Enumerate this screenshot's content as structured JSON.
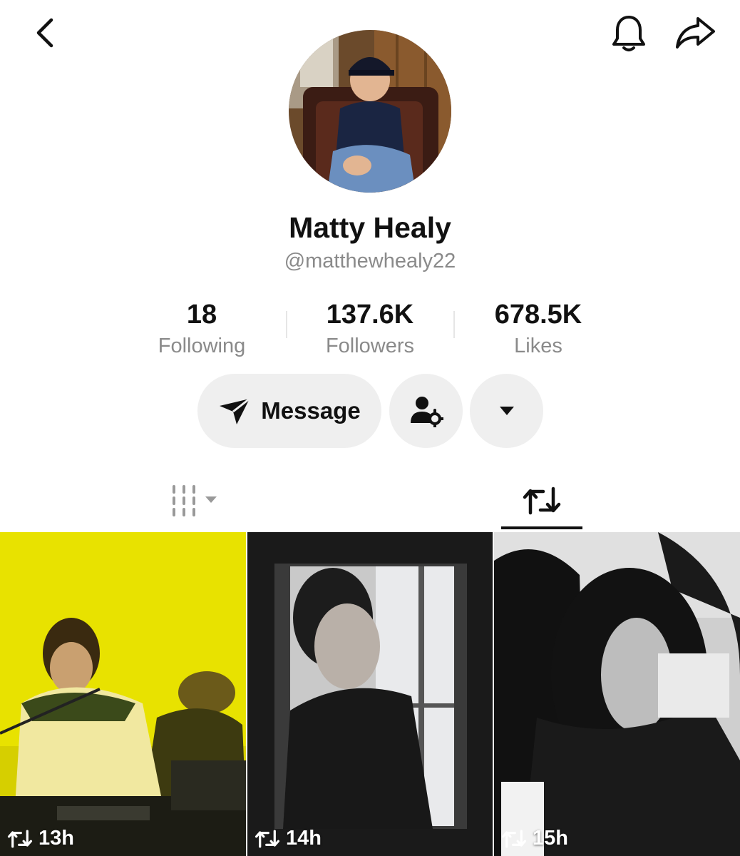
{
  "profile": {
    "name": "Matty Healy",
    "handle": "@matthewhealy22"
  },
  "stats": [
    {
      "value": "18",
      "label": "Following"
    },
    {
      "value": "137.6K",
      "label": "Followers"
    },
    {
      "value": "678.5K",
      "label": "Likes"
    }
  ],
  "actions": {
    "message_label": "Message"
  },
  "icons": {
    "back": "chevron-left-icon",
    "notifications": "bell-icon",
    "share": "share-arrow-icon",
    "message": "send-icon",
    "friends": "user-settings-icon",
    "more": "caret-down-icon",
    "videos_tab": "grid-columns-icon",
    "reposts_tab": "repost-icon"
  },
  "tabs": {
    "active": "reposts"
  },
  "grid": [
    {
      "time": "13h"
    },
    {
      "time": "14h"
    },
    {
      "time": "15h"
    }
  ],
  "colors": {
    "text_primary": "#111111",
    "text_secondary": "#8a8a8a",
    "button_bg": "#efefef"
  }
}
